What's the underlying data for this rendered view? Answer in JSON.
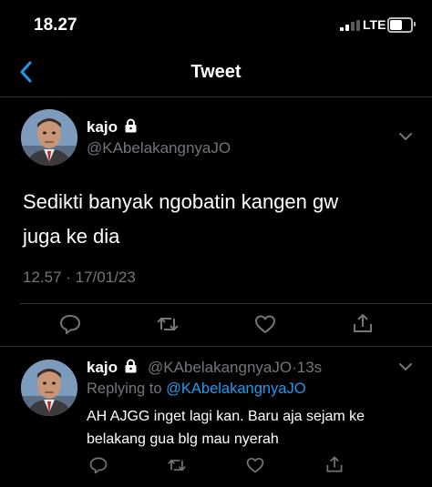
{
  "status_bar": {
    "time": "18.27",
    "network": "LTE"
  },
  "header": {
    "title": "Tweet"
  },
  "main_tweet": {
    "name": "kajo",
    "handle": "@KAbelakangnyaJO",
    "text_line1": "Sedikti banyak ngobatin kangen gw",
    "text_line2": "juga ke dia",
    "meta": "12.57 · 17/01/23"
  },
  "reply_tweet": {
    "name": "kajo",
    "handle_time": "@KAbelakangnyaJO·13s",
    "replying_prefix": "Replying to ",
    "replying_to": "@KAbelakangnyaJO",
    "text_line1": "AH AJGG inget lagi kan. Baru aja sejam ke",
    "text_line2": "belakang gua blg mau nyerah"
  },
  "icons": {
    "back": "chevron-left-icon",
    "lock": "lock-icon",
    "more": "chevron-down-icon",
    "reply": "reply-icon",
    "retweet": "retweet-icon",
    "like": "heart-icon",
    "share": "share-icon"
  },
  "colors": {
    "background": "#000000",
    "accent": "#1d9bf0",
    "secondary_text": "#71767b",
    "divider": "#2f3336"
  }
}
